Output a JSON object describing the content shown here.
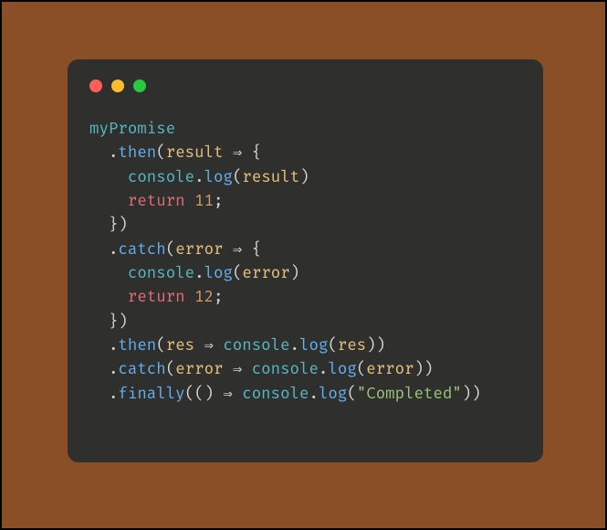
{
  "colors": {
    "frame": "#000000",
    "bg": "#8b4f27",
    "window": "#2f2f2d",
    "traffic": {
      "red": "#ff5f56",
      "yellow": "#ffbd2e",
      "green": "#27c93f"
    },
    "syntax": {
      "ident": "#56b6c2",
      "method": "#61afef",
      "builtin": "#56b6c2",
      "param": "#e5c07b",
      "keyword": "#e06c75",
      "number": "#d19a66",
      "string": "#98c379",
      "operator": "#d4d4cf",
      "punct": "#d4d4cf"
    }
  },
  "code": {
    "obj": "myPromise",
    "arrow": "⇒",
    "dot": ".",
    "open_paren": "(",
    "close_paren": ")",
    "open_brace": "{",
    "close_brace": "}",
    "close_brace_paren": "})",
    "unit": "()",
    "comma": ",",
    "semi": ";",
    "kw_return": "return",
    "methods": {
      "then": "then",
      "catch": "catch",
      "finally": "finally",
      "log": "log"
    },
    "builtins": {
      "console": "console"
    },
    "params": {
      "result": "result",
      "error": "error",
      "res": "res"
    },
    "nums": {
      "eleven": "11",
      "twelve": "12"
    },
    "strings": {
      "completed": "\"Completed\""
    }
  }
}
